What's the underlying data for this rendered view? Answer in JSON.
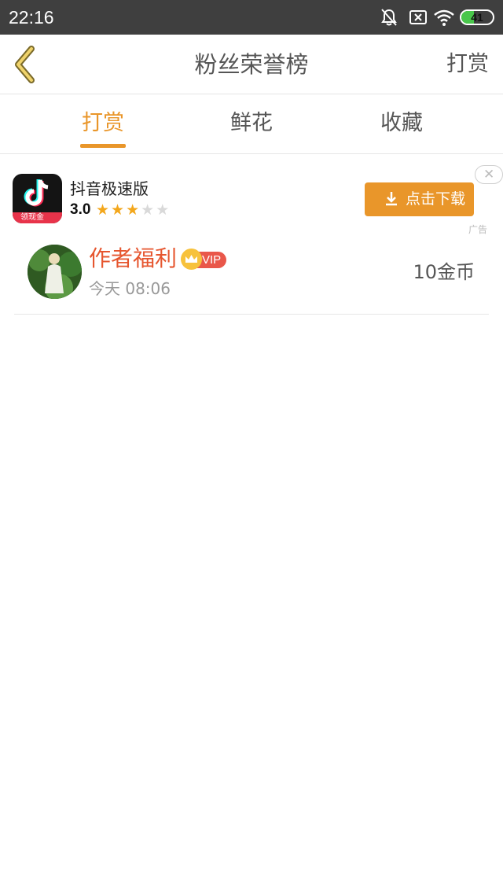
{
  "status_bar": {
    "time": "22:16",
    "battery_level": "41",
    "icons": [
      "bell-off-icon",
      "sim-off-icon",
      "wifi-icon",
      "battery-icon"
    ]
  },
  "header": {
    "back_icon": "chevron-left-icon",
    "title": "粉丝荣誉榜",
    "action_label": "打赏"
  },
  "tabs": [
    {
      "label": "打赏",
      "active": true
    },
    {
      "label": "鲜花",
      "active": false
    },
    {
      "label": "收藏",
      "active": false
    }
  ],
  "ad": {
    "app_name": "抖音极速版",
    "icon_badge": "领现金",
    "rating": "3.0",
    "stars": 3,
    "max_stars": 5,
    "download_label": "点击下载",
    "close_icon": "close-icon",
    "tag": "广告"
  },
  "rewards": [
    {
      "name": "作者福利",
      "badge": "VIP",
      "time": "今天 08:06",
      "amount": "10金币"
    }
  ],
  "colors": {
    "accent": "#e9962a",
    "status_bar": "#3f3f3f",
    "name_red": "#e6562f",
    "vip_red": "#e9574a",
    "battery_green": "#49c64b"
  }
}
